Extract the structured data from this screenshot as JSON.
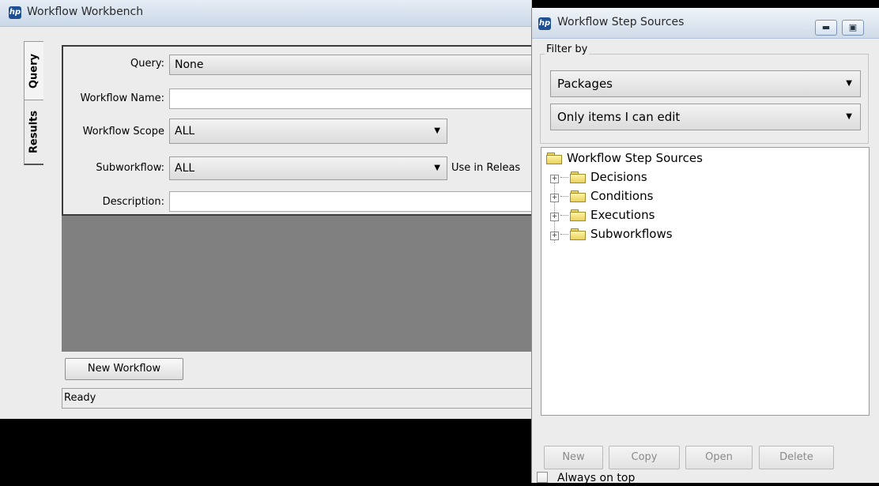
{
  "workbench": {
    "title": "Workflow Workbench",
    "tabs": [
      {
        "label": "Query"
      },
      {
        "label": "Results"
      }
    ],
    "form": {
      "query_label": "Query:",
      "query_value": "None",
      "name_label": "Workflow Name:",
      "name_value": "",
      "scope_label": "Workflow Scope",
      "scope_value": "ALL",
      "sub_label": "Subworkflow:",
      "sub_value": "ALL",
      "use_in_release_label": "Use in Releas",
      "desc_label": "Description:",
      "desc_value": ""
    },
    "new_workflow_label": "New Workflow",
    "status": "Ready"
  },
  "sources": {
    "title": "Workflow Step Sources",
    "minimize_icon": "minimize-icon",
    "maximize_icon": "maximize-icon",
    "filter_legend": "Filter by",
    "filter1_value": "Packages",
    "filter2_value": "Only items I can edit",
    "tree_root": "Workflow Step Sources",
    "tree_items": [
      {
        "label": "Decisions"
      },
      {
        "label": "Conditions"
      },
      {
        "label": "Executions"
      },
      {
        "label": "Subworkflows"
      }
    ],
    "buttons": {
      "new": "New",
      "copy": "Copy",
      "open": "Open",
      "delete": "Delete"
    },
    "always_on_top_label": "Always on top",
    "always_on_top_checked": false
  }
}
